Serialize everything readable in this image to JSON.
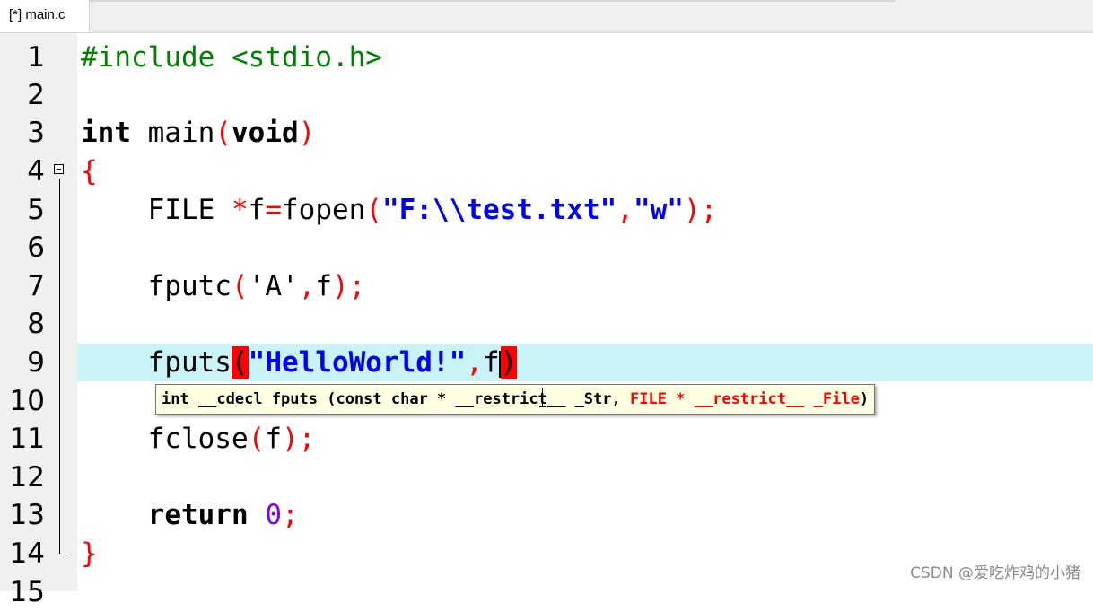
{
  "tab": {
    "label": "[*] main.c"
  },
  "gutter": {
    "line_numbers": [
      "1",
      "2",
      "3",
      "4",
      "5",
      "6",
      "7",
      "8",
      "9",
      "10",
      "11",
      "12",
      "13",
      "14",
      "15"
    ]
  },
  "code": {
    "l1": {
      "directive": "#include <stdio.h>"
    },
    "l3": {
      "kw_int": "int",
      "name": "main",
      "lparen": "(",
      "kw_void": "void",
      "rparen": ")"
    },
    "l4": {
      "brace": "{"
    },
    "l5": {
      "type": "FILE",
      "star": "*",
      "var": "f",
      "eq": "=",
      "fn": "fopen",
      "lparen": "(",
      "str1": "\"F:\\\\test.txt\"",
      "comma": ",",
      "str2": "\"w\"",
      "rparen": ")",
      "semi": ";"
    },
    "l7": {
      "fn": "fputc",
      "lparen": "(",
      "chr": "'A'",
      "comma": ",",
      "arg": "f",
      "rparen": ")",
      "semi": ";"
    },
    "l9": {
      "fn": "fputs",
      "lparen": "(",
      "str": "\"HelloWorld!\"",
      "comma": ",",
      "arg": "f",
      "rparen": ")"
    },
    "l11": {
      "fn": "fclose",
      "lparen": "(",
      "arg": "f",
      "rparen": ")",
      "semi": ";"
    },
    "l13": {
      "kw": "return",
      "num": "0",
      "semi": ";"
    },
    "l14": {
      "brace": "}"
    }
  },
  "tooltip": {
    "part1": "int __cdecl fputs (const char * __restrict__ _Str, ",
    "part2": "FILE * __restrict__ _File",
    "part3": ")"
  },
  "watermark": {
    "text": "CSDN @爱吃炸鸡的小猪"
  },
  "colors": {
    "current_line": "#c8f4f8",
    "bracket_match": "#ff0000",
    "tooltip_bg": "#ffffe1"
  }
}
